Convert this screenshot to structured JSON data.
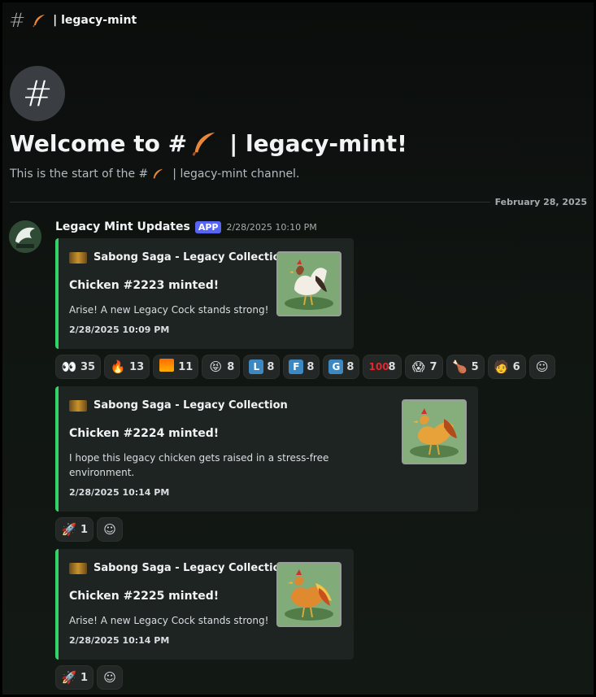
{
  "header": {
    "channel_name": "| legacy-mint"
  },
  "welcome": {
    "title_prefix": "Welcome to #",
    "title_suffix": "| legacy-mint!",
    "sub_prefix": "This is the start of the #",
    "sub_suffix": "| legacy-mint channel."
  },
  "date_divider": "February 28, 2025",
  "message": {
    "author": "Legacy Mint Updates",
    "tag": "APP",
    "timestamp": "2/28/2025 10:10 PM"
  },
  "embeds": [
    {
      "provider": "Sabong Saga - Legacy Collection",
      "title": "Chicken #2223 minted!",
      "description": "Arise! A new Legacy Cock stands strong!",
      "time": "2/28/2025 10:09 PM"
    },
    {
      "provider": "Sabong Saga - Legacy Collection",
      "title": "Chicken #2224 minted!",
      "description": "I hope this legacy chicken gets raised in a stress-free environment.",
      "time": "2/28/2025 10:14 PM"
    },
    {
      "provider": "Sabong Saga - Legacy Collection",
      "title": "Chicken #2225 minted!",
      "description": "Arise! A new Legacy Cock stands strong!",
      "time": "2/28/2025 10:14 PM"
    }
  ],
  "reactions1": [
    {
      "icon": "eyes-emoji",
      "emoji": "👀",
      "count": "35"
    },
    {
      "icon": "fire-hand-emoji",
      "emoji": "🔥",
      "count": "13"
    },
    {
      "icon": "burning-box-emoji",
      "emoji": "🔥",
      "count": "11"
    },
    {
      "icon": "laughing-face-emoji",
      "emoji": "😝",
      "count": "8"
    },
    {
      "icon": "letter-l-emoji",
      "emoji": "L",
      "color": "#3b88c3",
      "count": "8"
    },
    {
      "icon": "letter-f-emoji",
      "emoji": "F",
      "color": "#3b88c3",
      "count": "8"
    },
    {
      "icon": "letter-g-emoji",
      "emoji": "G",
      "color": "#3b88c3",
      "count": "8"
    },
    {
      "icon": "hundred-emoji",
      "emoji": "💯",
      "count": "8"
    },
    {
      "icon": "shocked-face-emoji",
      "emoji": "😱",
      "count": "7"
    },
    {
      "icon": "chicken-leg-emoji",
      "emoji": "🍗",
      "count": "5"
    },
    {
      "icon": "farmer-emoji",
      "emoji": "🧑",
      "count": "6"
    }
  ],
  "reactions2": [
    {
      "icon": "rocket-emoji",
      "emoji": "🚀",
      "count": "1"
    }
  ],
  "reactions3": [
    {
      "icon": "rocket-emoji",
      "emoji": "🚀",
      "count": "1"
    }
  ],
  "colors": {
    "embed_accent": "#33d467",
    "app_tag": "#5865f2"
  }
}
